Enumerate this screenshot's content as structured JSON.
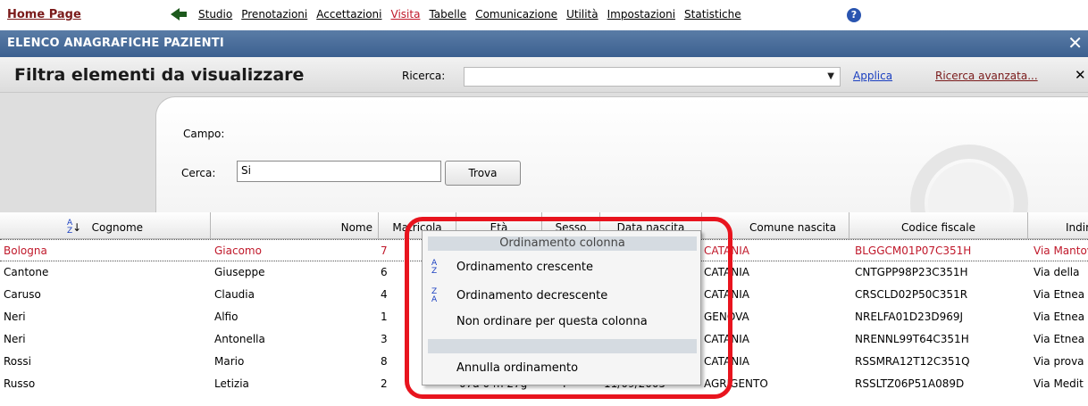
{
  "menubar": {
    "home": "Home Page",
    "items": [
      "Studio",
      "Prenotazioni",
      "Accettazioni",
      "Visita",
      "Tabelle",
      "Comunicazione",
      "Utilità",
      "Impostazioni",
      "Statistiche"
    ],
    "active_item": "Visita",
    "help_glyph": "?"
  },
  "window": {
    "title": "ELENCO ANAGRAFICHE PAZIENTI",
    "close_glyph": "✕"
  },
  "filter": {
    "title": "Filtra elementi da visualizzare",
    "ricerca_label": "Ricerca:",
    "ricerca_value": "",
    "apply_link": "Applica",
    "advanced_link": "Ricerca avanzata...",
    "close_glyph": "✕"
  },
  "search": {
    "campo_label": "Campo:",
    "cerca_label": "Cerca:",
    "cerca_value": "Si",
    "trova_button": "Trova"
  },
  "grid": {
    "columns": [
      "Cognome",
      "Nome",
      "Matricola",
      "Età",
      "Sesso",
      "Data nascita",
      "Comune nascita",
      "Codice fiscale",
      "Indirizzo"
    ],
    "rows": [
      {
        "cognome": "Bologna",
        "nome": "Giacomo",
        "matricola": "7",
        "eta": "",
        "sesso": "",
        "data": "",
        "comune": "CATANIA",
        "cf": "BLGGCM01P07C351H",
        "indirizzo": "Via Mantova"
      },
      {
        "cognome": "Cantone",
        "nome": "Giuseppe",
        "matricola": "6",
        "eta": "",
        "sesso": "",
        "data": "",
        "comune": "CATANIA",
        "cf": "CNTGPP98P23C351H",
        "indirizzo": "Via della"
      },
      {
        "cognome": "Caruso",
        "nome": "Claudia",
        "matricola": "4",
        "eta": "",
        "sesso": "",
        "data": "",
        "comune": "CATANIA",
        "cf": "CRSCLD02P50C351R",
        "indirizzo": "Via Etnea"
      },
      {
        "cognome": "Neri",
        "nome": "Alfio",
        "matricola": "1",
        "eta": "",
        "sesso": "",
        "data": "",
        "comune": "GENOVA",
        "cf": "NRELFA01D23D969J",
        "indirizzo": "Via Etnea"
      },
      {
        "cognome": "Neri",
        "nome": "Antonella",
        "matricola": "3",
        "eta": "",
        "sesso": "",
        "data": "",
        "comune": "CATANIA",
        "cf": "NRENNL99T64C351H",
        "indirizzo": "Via Etnea"
      },
      {
        "cognome": "Rossi",
        "nome": "Mario",
        "matricola": "8",
        "eta": "",
        "sesso": "",
        "data": "",
        "comune": "CATANIA",
        "cf": "RSSMRA12T12C351Q",
        "indirizzo": "Via prova"
      },
      {
        "cognome": "Russo",
        "nome": "Letizia",
        "matricola": "2",
        "eta": "07a 0 m 27g",
        "sesso": "F",
        "data": "11/09/2005",
        "comune": "AGRIGENTO",
        "cf": "RSSLTZ06P51A089D",
        "indirizzo": "Via Medit"
      }
    ],
    "sort_icon_up": "A\nZ",
    "sort_icon_down": "Z\nA"
  },
  "context_menu": {
    "header": "Ordinamento colonna",
    "items": [
      "Ordinamento crescente",
      "Ordinamento decrescente",
      "Non ordinare per questa colonna",
      "Annulla ordinamento"
    ]
  },
  "colors": {
    "titlebar": "#3c6090",
    "accent_red": "#c0182a",
    "link_blue": "#1a3fc0",
    "highlight_ring": "#e8141e"
  }
}
